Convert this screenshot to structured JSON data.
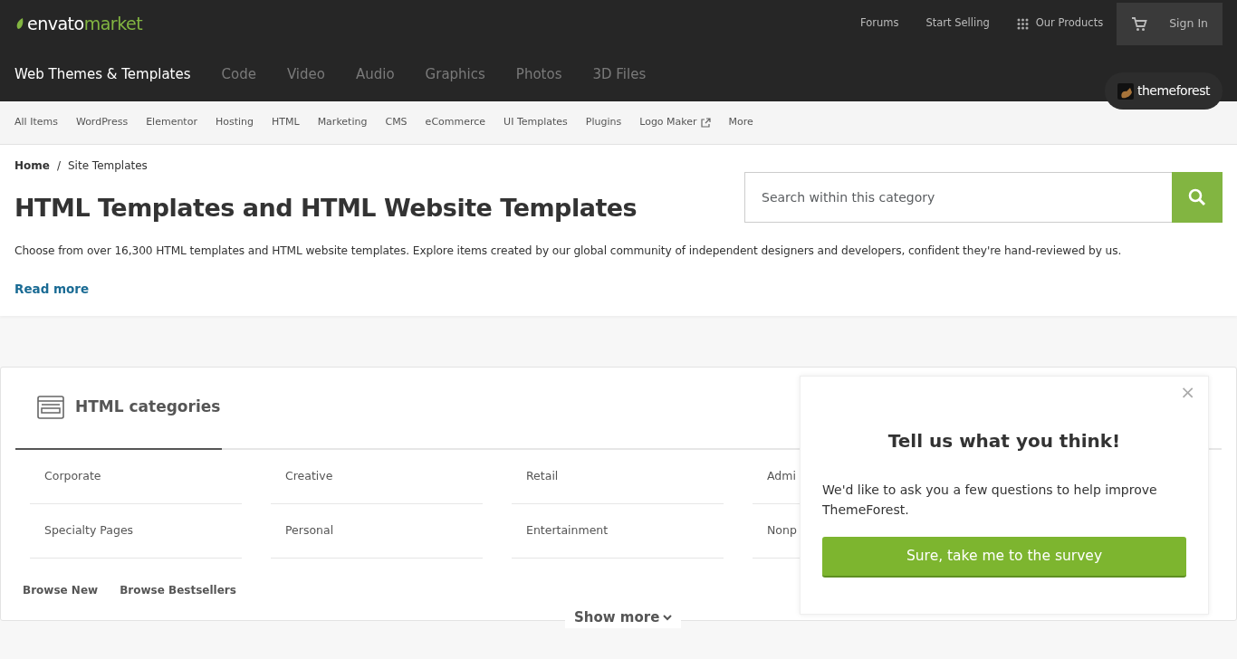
{
  "logo": {
    "brand": "envato",
    "product": "market"
  },
  "top_links": [
    {
      "label": "Forums",
      "kind": "link"
    },
    {
      "label": "Start Selling",
      "kind": "link"
    },
    {
      "label": "Our Products",
      "kind": "grid"
    }
  ],
  "sign_in": {
    "label": "Sign In"
  },
  "main_nav": [
    {
      "label": "Web Themes & Templates",
      "selected": true
    },
    {
      "label": "Code",
      "selected": false
    },
    {
      "label": "Video",
      "selected": false
    },
    {
      "label": "Audio",
      "selected": false
    },
    {
      "label": "Graphics",
      "selected": false
    },
    {
      "label": "Photos",
      "selected": false
    },
    {
      "label": "3D Files",
      "selected": false
    }
  ],
  "site_badge": {
    "label": "themeforest"
  },
  "sub_nav": [
    {
      "label": "All Items",
      "external": false
    },
    {
      "label": "WordPress",
      "external": false
    },
    {
      "label": "Elementor",
      "external": false
    },
    {
      "label": "Hosting",
      "external": false
    },
    {
      "label": "HTML",
      "external": false
    },
    {
      "label": "Marketing",
      "external": false
    },
    {
      "label": "CMS",
      "external": false
    },
    {
      "label": "eCommerce",
      "external": false
    },
    {
      "label": "UI Templates",
      "external": false
    },
    {
      "label": "Plugins",
      "external": false
    },
    {
      "label": "Logo Maker",
      "external": true
    },
    {
      "label": "More",
      "external": false
    }
  ],
  "breadcrumb": [
    "Home",
    "Site Templates"
  ],
  "breadcrumb_separator": "/",
  "heading": "HTML Templates and HTML Website Templates",
  "description": "Choose from over 16,300 HTML templates and HTML website templates. Explore items created by our global community of independent designers and developers, confident they're hand-reviewed by us.",
  "read_more": "Read more",
  "search": {
    "placeholder": "Search within this category"
  },
  "categories": {
    "title": "HTML categories",
    "columns": [
      [
        "Corporate",
        "Specialty Pages"
      ],
      [
        "Creative",
        "Personal"
      ],
      [
        "Retail",
        "Entertainment"
      ],
      [
        "Admi",
        "Nonp"
      ]
    ],
    "links": [
      "Browse New",
      "Browse Bestsellers"
    ],
    "show_more": "Show more"
  },
  "survey": {
    "title": "Tell us what you think!",
    "body": "We'd like to ask you a few questions to help improve ThemeForest.",
    "button": "Sure, take me to the survey",
    "close": "×"
  }
}
